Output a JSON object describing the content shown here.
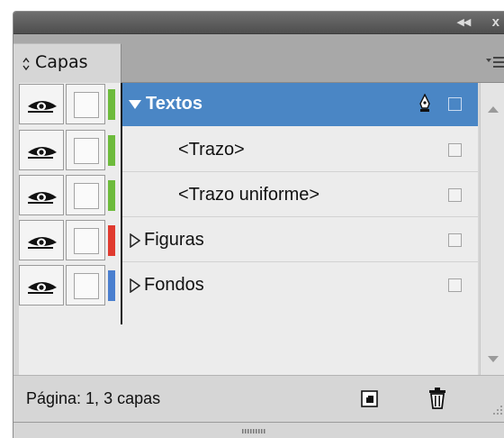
{
  "panel": {
    "tab_label": "Capas",
    "collapse_glyph": "◂◂",
    "close_glyph": "x"
  },
  "layers": [
    {
      "label": "Textos",
      "indent": 0,
      "expanded": true,
      "selected": true,
      "visible": true,
      "color": "#6dbb3c",
      "pen_icon": true
    },
    {
      "label": "<Trazo>",
      "indent": 1,
      "selected": false,
      "visible": true,
      "color": "#6dbb3c"
    },
    {
      "label": "<Trazo uniforme>",
      "indent": 1,
      "selected": false,
      "visible": true,
      "color": "#6dbb3c"
    },
    {
      "label": "Figuras",
      "indent": 0,
      "expanded": false,
      "selected": false,
      "visible": true,
      "color": "#e03a2f"
    },
    {
      "label": "Fondos",
      "indent": 0,
      "expanded": false,
      "selected": false,
      "visible": true,
      "color": "#4a7fcf"
    }
  ],
  "status": {
    "text": "Página: 1, 3 capas"
  },
  "icons": {
    "new_layer": "new-layer-icon",
    "delete": "trash-icon",
    "menu": "panel-menu-icon"
  }
}
